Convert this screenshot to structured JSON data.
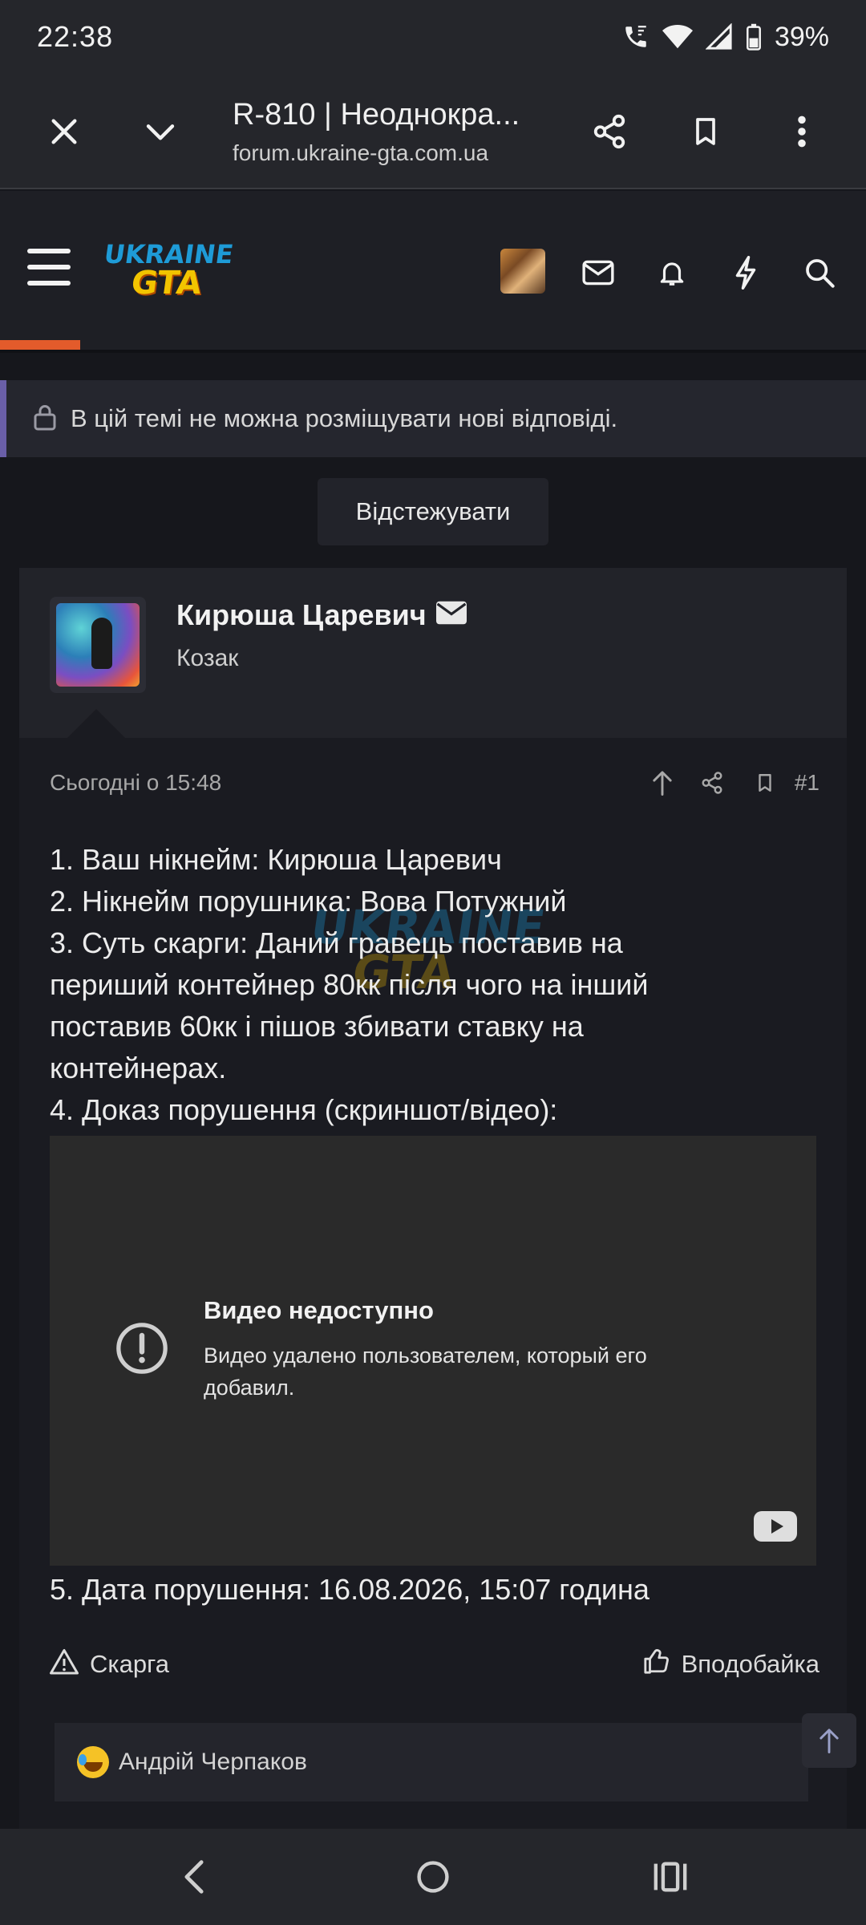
{
  "status_bar": {
    "time": "22:38",
    "battery": "39%",
    "icons": [
      "wifi-call-icon",
      "wifi-icon",
      "signal-icon",
      "battery-icon"
    ]
  },
  "browser": {
    "title": "R-810 | Неоднокра...",
    "url": "forum.ukraine-gta.com.ua",
    "icons": [
      "close-icon",
      "chevron-down-icon",
      "share-icon",
      "bookmark-icon",
      "more-vert-icon"
    ]
  },
  "site_header": {
    "logo_line1": "UKRAINE",
    "logo_line2": "GTA",
    "icons": [
      "menu-icon",
      "avatar-thumb",
      "mail-icon",
      "bell-icon",
      "lightning-icon",
      "search-icon"
    ],
    "accent": "#e35b2b"
  },
  "notice": {
    "text": "В цій темі не можна розміщувати нові відповіді."
  },
  "watch_button": {
    "label": "Відстежувати"
  },
  "post": {
    "author": "Кирюша Царевич",
    "rank": "Козак",
    "date": "Сьогодні о 15:48",
    "number": "#1",
    "lines": [
      "1. Ваш нікнейм: Кирюша Царевич",
      "2. Нікнейм порушника: Вова Потужний",
      "3. Суть скарги: Даний гравець поставив на",
      "периший контейнер 80кк після чого на інший",
      "поставив 60кк і пішов збивати ставку на",
      "контейнерах.",
      "4. Доказ порушення (скриншот/відео):"
    ],
    "video": {
      "title": "Видео недоступно",
      "description": "Видео удалено пользователем, который его добавил."
    },
    "line_after_video": "5. Дата порушення: 16.08.2026, 15:07 година",
    "report_label": "Скарга",
    "like_label": "Вподобайка",
    "reaction_user": "Андрій Черпаков"
  },
  "watermark": {
    "line1": "UKRAINE",
    "line2": "GTA"
  }
}
